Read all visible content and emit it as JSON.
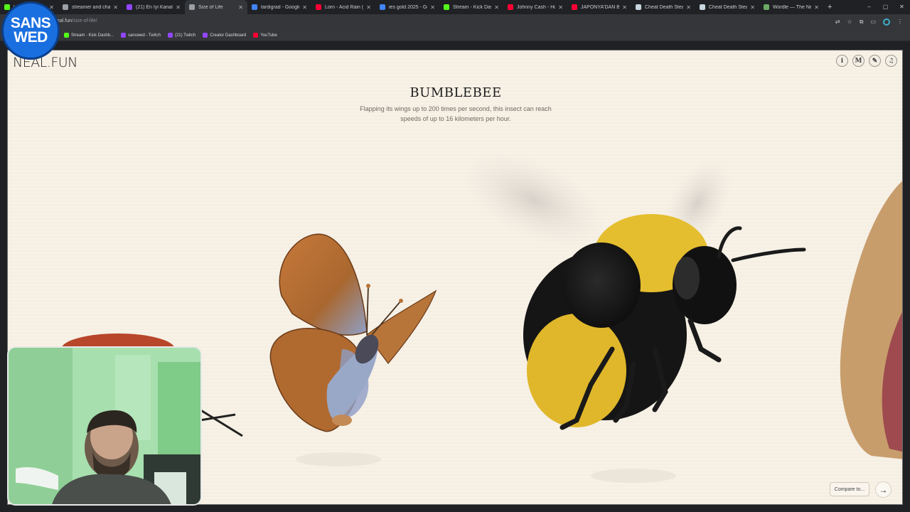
{
  "browser": {
    "tabs": [
      {
        "label": "k Dashb",
        "color": "#53fc18",
        "active": false
      },
      {
        "label": "streamer and chat g",
        "color": "#9aa0a6",
        "active": false
      },
      {
        "label": "(21) En İyi Kanallar",
        "color": "#9146ff",
        "active": false
      },
      {
        "label": "Size of Life",
        "color": "#9aa0a6",
        "active": true
      },
      {
        "label": "tardigrad - Google'",
        "color": "#4285f4",
        "active": false
      },
      {
        "label": "Lorn - Acid Rain (Of",
        "color": "#ff0033",
        "active": false
      },
      {
        "label": "ies gold 2025 - Goo",
        "color": "#4285f4",
        "active": false
      },
      {
        "label": "Stream - Kick Dashb",
        "color": "#53fc18",
        "active": false
      },
      {
        "label": "Johnny Cash - Hurt",
        "color": "#ff0033",
        "active": false
      },
      {
        "label": "JAPONYA'DAN BIKI",
        "color": "#ff0033",
        "active": false
      },
      {
        "label": "Cheat Death Steam",
        "color": "#c7d5e0",
        "active": false
      },
      {
        "label": "Cheat Death Steam",
        "color": "#c7d5e0",
        "active": false
      },
      {
        "label": "Wordle — The New",
        "color": "#6aaa64",
        "active": false
      }
    ],
    "new_tab": "+",
    "window_controls": [
      "–",
      "▢",
      "✕"
    ],
    "url_host": "eal.fun",
    "url_path": "/size-of-life/",
    "bookmarks": [
      {
        "label": "Stream - Kick Dashb...",
        "color": "#53fc18"
      },
      {
        "label": "sanswed - Twitch",
        "color": "#9146ff"
      },
      {
        "label": "(21) Twitch",
        "color": "#9146ff"
      },
      {
        "label": "Creator Dashboard",
        "color": "#9146ff"
      },
      {
        "label": "YouTube",
        "color": "#ff0033"
      }
    ]
  },
  "overlay": {
    "logo_line1": "SANS",
    "logo_line2": "WED"
  },
  "page": {
    "brand": "NEAL.FUN",
    "icons": [
      "info-icon",
      "m-icon",
      "pencil-icon",
      "music-icon"
    ],
    "icon_glyphs": [
      "i",
      "M",
      "✎",
      "♫"
    ],
    "title": "BUMBLEBEE",
    "description": "Flapping its wings up to 200 times per second, this insect can reach speeds of up to 16 kilometers per hour.",
    "compare_label": "Compare to...",
    "next_glyph": "→"
  }
}
